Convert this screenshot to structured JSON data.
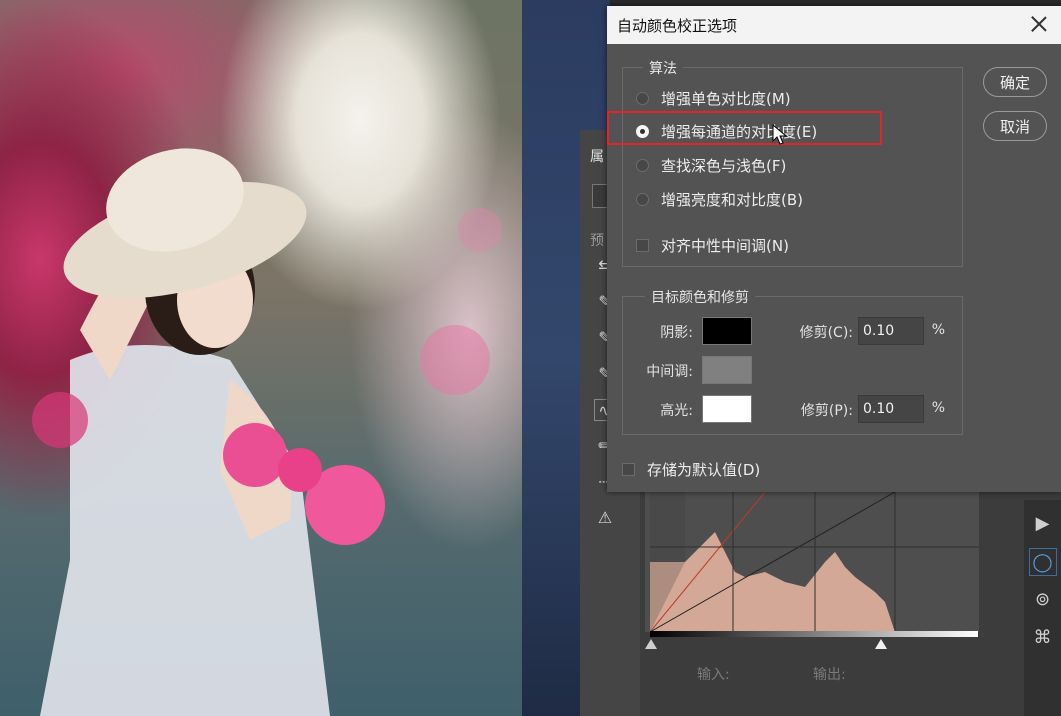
{
  "dialog": {
    "title": "自动颜色校正选项",
    "algorithm_group": "算法",
    "options": [
      {
        "label": "增强单色对比度(M)",
        "checked": false
      },
      {
        "label": "增强每通道的对比度(E)",
        "checked": true
      },
      {
        "label": "查找深色与浅色(F)",
        "checked": false
      },
      {
        "label": "增强亮度和对比度(B)",
        "checked": false
      }
    ],
    "snap_neutral_label": "对齐中性中间调(N)",
    "target_group": "目标颜色和修剪",
    "shadows_label": "阴影:",
    "midtones_label": "中间调:",
    "highlights_label": "高光:",
    "clip_shadow_label": "修剪(C):",
    "clip_shadow_value": "0.10",
    "clip_highlight_label": "修剪(P):",
    "clip_highlight_value": "0.10",
    "percent": "%",
    "save_default_label": "存储为默认值(D)",
    "ok_label": "确定",
    "cancel_label": "取消",
    "colors": {
      "shadow": "#000000",
      "midtone": "#808080",
      "highlight": "#ffffff"
    }
  },
  "panel": {
    "input_label": "输入:",
    "output_label": "输出:",
    "partial_text": {
      "properties": "属",
      "preset": "预"
    }
  },
  "icons": [
    "adjust-icon",
    "eyedropper-black-icon",
    "eyedropper-gray-icon",
    "eyedropper-white-icon",
    "curve-icon",
    "pencil-icon",
    "smooth-icon",
    "warning-icon",
    "play-icon",
    "circle-icon",
    "channels-icon",
    "path-icon"
  ]
}
